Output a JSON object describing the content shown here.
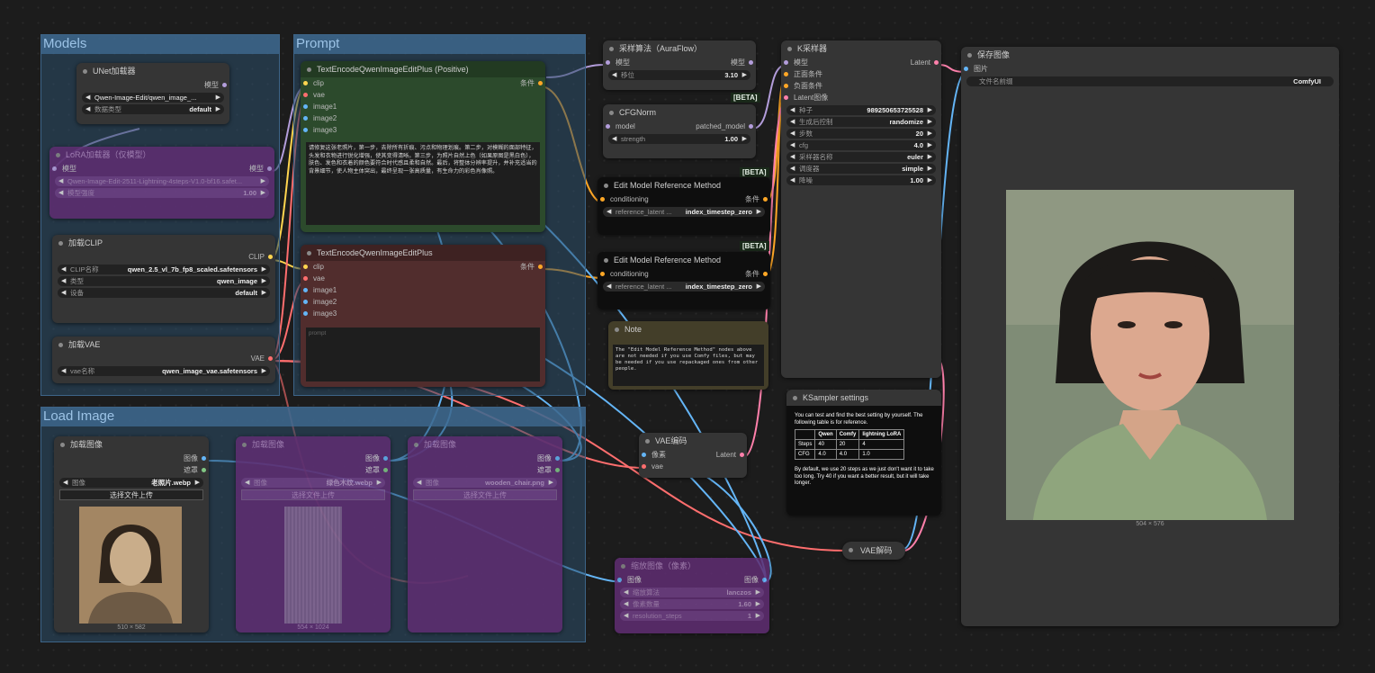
{
  "groups": {
    "models": "Models",
    "prompt": "Prompt",
    "load_image": "Load Image"
  },
  "unet": {
    "title": "UNet加载器",
    "out_model": "模型",
    "unet_name": "Qwen-Image-Edit/qwen_image_...",
    "dtype_label": "数据类型",
    "dtype": "default"
  },
  "lora": {
    "title": "LoRA加载器（仅模型）",
    "in_model": "模型",
    "out_model": "模型",
    "lora_name": "Qwen-Image-Edit-2511-Lightning-4steps-V1.0-bf16.safet...",
    "strength_label": "模型强度",
    "strength": "1.00"
  },
  "clip": {
    "title": "加载CLIP",
    "out": "CLIP",
    "name_label": "CLIP名称",
    "name": "qwen_2.5_vl_7b_fp8_scaled.safetensors",
    "type_label": "类型",
    "type": "qwen_image",
    "device_label": "设备",
    "device": "default"
  },
  "vae_loader": {
    "title": "加载VAE",
    "out": "VAE",
    "name_label": "vae名称",
    "name": "qwen_image_vae.safetensors"
  },
  "pos": {
    "title": "TextEncodeQwenImageEditPlus (Positive)",
    "inputs": [
      "clip",
      "vae",
      "image1",
      "image2",
      "image3"
    ],
    "out": "条件",
    "text": "请修复这张老照片，第一步，去除所有折痕、污点和物理划痕。第二步，对模糊的面部特征，头发和衣物进行锐化增强，使其变得清晰。第三步，为照片自然上色（如果原图是黑白色），肤色、发色和衣着的颜色要符合时代感且柔和自然。最后，将整体分辨率提升，并补充适当的背景细节，使人物主体突出，最终呈现一张高质量，有生命力的彩色肖像照。"
  },
  "neg": {
    "title": "TextEncodeQwenImageEditPlus",
    "inputs": [
      "clip",
      "vae",
      "image1",
      "image2",
      "image3"
    ],
    "out": "条件",
    "placeholder": "prompt"
  },
  "sampling": {
    "title": "采样算法（AuraFlow）",
    "in": "模型",
    "out": "模型",
    "shift_label": "移位",
    "shift": "3.10"
  },
  "cfgnorm": {
    "title": "CFGNorm",
    "in": "model",
    "out": "patched_model",
    "strength_label": "strength",
    "strength": "1.00"
  },
  "beta": "[BETA]",
  "emr1": {
    "title": "Edit Model Reference Method",
    "in": "conditioning",
    "out": "条件",
    "label": "reference_latent ...",
    "value": "index_timestep_zero"
  },
  "emr2": {
    "title": "Edit Model Reference Method",
    "in": "conditioning",
    "out": "条件",
    "label": "reference_latent ...",
    "value": "index_timestep_zero"
  },
  "note": {
    "title": "Note",
    "text": "The \"Edit Model Reference Method\" nodes above are not needed if you use Comfy files, but may be needed if you use repackaged ones from other people."
  },
  "ksampler": {
    "title": "K采样器",
    "inputs": [
      "模型",
      "正面条件",
      "负面条件",
      "Latent图像"
    ],
    "out": "Latent",
    "widgets": [
      {
        "label": "种子",
        "value": "989250653725528"
      },
      {
        "label": "生成后控制",
        "value": "randomize"
      },
      {
        "label": "步数",
        "value": "20"
      },
      {
        "label": "cfg",
        "value": "4.0"
      },
      {
        "label": "采样器名称",
        "value": "euler"
      },
      {
        "label": "调度器",
        "value": "simple"
      },
      {
        "label": "降噪",
        "value": "1.00"
      }
    ]
  },
  "ks_settings": {
    "title": "KSampler settings",
    "intro": "You can test and find the best setting by yourself. The following table is for reference.",
    "header": [
      "",
      "Qwen",
      "Comfy",
      "lightning LoRA"
    ],
    "rows": [
      [
        "Steps",
        "40",
        "20",
        "4"
      ],
      [
        "CFG",
        "4.0",
        "4.0",
        "1.0"
      ]
    ],
    "footer": "By default, we use 20 steps as we just don't want it to take too long. Try 40 if you want a better result, but it will take longer."
  },
  "vae_encode": {
    "title": "VAE编码",
    "inputs": [
      "像素",
      "vae"
    ],
    "out": "Latent"
  },
  "vae_decode": {
    "title": "VAE解码"
  },
  "save": {
    "title": "保存图像",
    "in": "图片",
    "prefix_label": "文件名前缀",
    "prefix": "ComfyUI",
    "size": "504 × 576"
  },
  "load1": {
    "title": "加载图像",
    "outs": [
      "图像",
      "遮罩"
    ],
    "image_label": "图像",
    "image": "老照片.webp",
    "upload": "选择文件上传",
    "size": "510 × 582"
  },
  "load2": {
    "title": "加载图像",
    "outs": [
      "图像",
      "遮罩"
    ],
    "image_label": "图像",
    "image": "绿色木纹.webp",
    "upload": "选择文件上传",
    "size": "554 × 1024"
  },
  "load3": {
    "title": "加载图像",
    "outs": [
      "图像",
      "遮罩"
    ],
    "image_label": "图像",
    "image": "wooden_chair.png",
    "upload": "选择文件上传"
  },
  "scale": {
    "title": "缩放图像（像素）",
    "in": "图像",
    "out": "图像",
    "w1_label": "缩放算法",
    "w1": "lanczos",
    "w2_label": "像素数量",
    "w2": "1.60",
    "w3_label": "resolution_steps",
    "w3": "1"
  }
}
